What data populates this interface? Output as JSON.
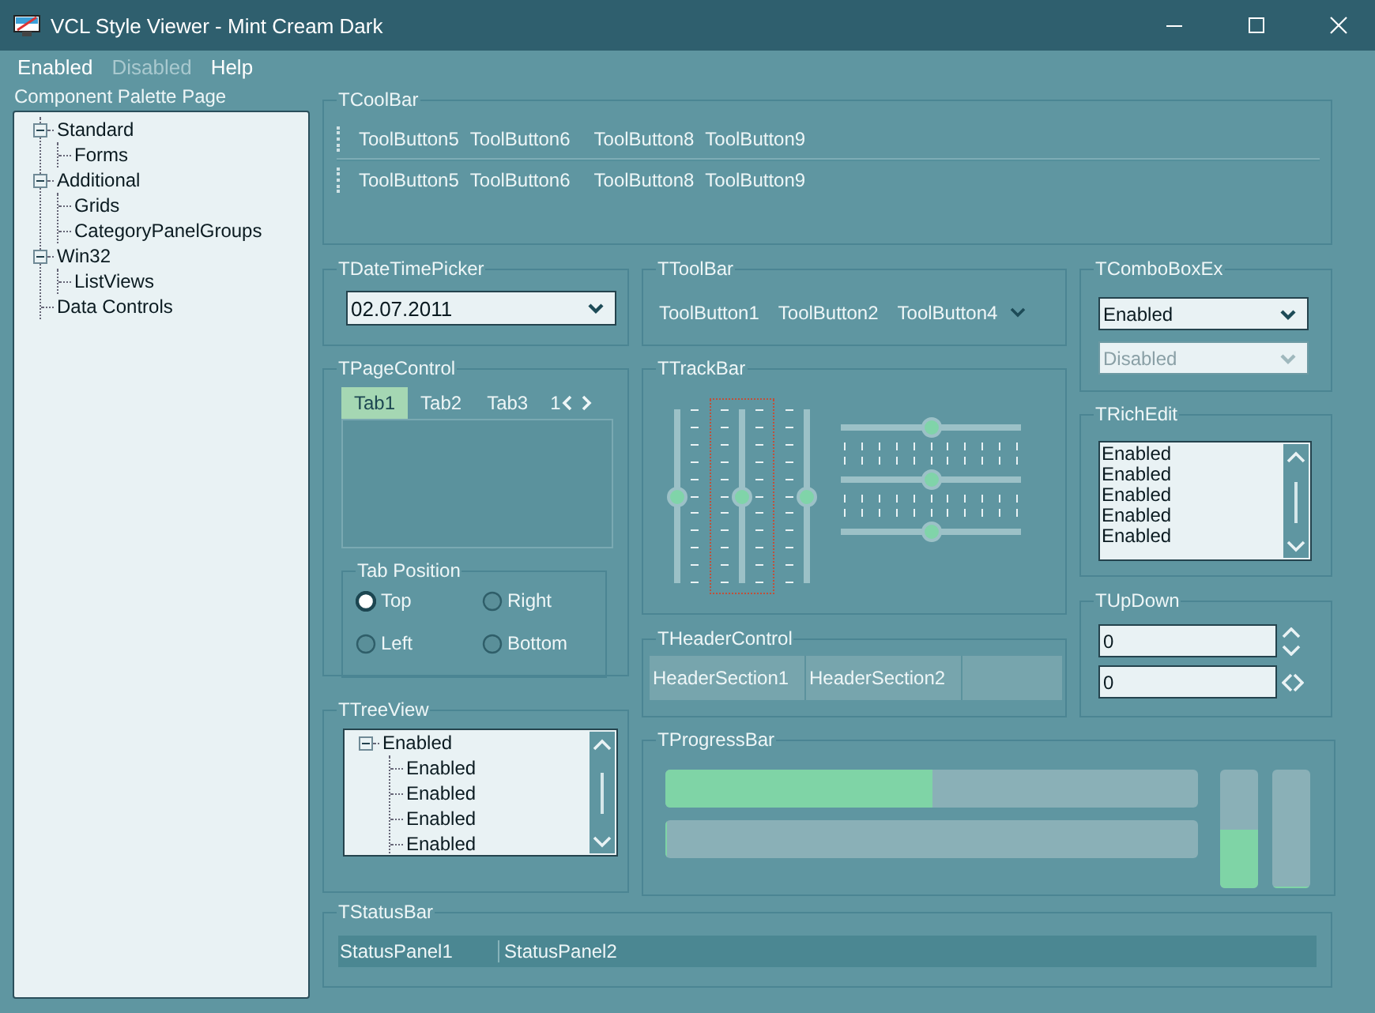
{
  "window": {
    "title": "VCL Style Viewer - Mint Cream Dark"
  },
  "menu": [
    {
      "label": "Enabled",
      "disabled": false
    },
    {
      "label": "Disabled",
      "disabled": true
    },
    {
      "label": "Help",
      "disabled": false
    }
  ],
  "sidebar": {
    "title": "Component Palette Page",
    "tree": [
      {
        "label": "Standard",
        "expanded": true,
        "children": [
          {
            "label": "Forms"
          }
        ]
      },
      {
        "label": "Additional",
        "expanded": true,
        "children": [
          {
            "label": "Grids"
          },
          {
            "label": "CategoryPanelGroups"
          }
        ]
      },
      {
        "label": "Win32",
        "expanded": true,
        "children": [
          {
            "label": "ListViews"
          }
        ]
      },
      {
        "label": "Data Controls"
      }
    ]
  },
  "coolbar": {
    "title": "TCoolBar",
    "bands": [
      {
        "buttons": [
          "ToolButton5",
          "ToolButton6",
          "ToolButton8",
          "ToolButton9"
        ]
      },
      {
        "buttons": [
          "ToolButton5",
          "ToolButton6",
          "ToolButton8",
          "ToolButton9"
        ]
      }
    ]
  },
  "datetimepicker": {
    "title": "TDateTimePicker",
    "value": "02.07.2011"
  },
  "toolbar": {
    "title": "TToolBar",
    "buttons": [
      "ToolButton1",
      "ToolButton2",
      "ToolButton4"
    ]
  },
  "comboboxex": {
    "title": "TComboBoxEx",
    "boxes": [
      {
        "value": "Enabled",
        "disabled": false
      },
      {
        "value": "Disabled",
        "disabled": true
      }
    ]
  },
  "pagecontrol": {
    "title": "TPageControl",
    "tabs": [
      {
        "label": "Tab1",
        "selected": true
      },
      {
        "label": "Tab2",
        "selected": false
      },
      {
        "label": "Tab3",
        "selected": false
      },
      {
        "label": "1",
        "selected": false
      }
    ],
    "tab_position": {
      "title": "Tab Position",
      "options": [
        {
          "label": "Top",
          "selected": true
        },
        {
          "label": "Right",
          "selected": false
        },
        {
          "label": "Left",
          "selected": false
        },
        {
          "label": "Bottom",
          "selected": false
        }
      ]
    }
  },
  "trackbar": {
    "title": "TTrackBar",
    "vertical": [
      {
        "level": 0.5,
        "kind": "right",
        "focused": false
      },
      {
        "level": 0.5,
        "kind": "both",
        "focused": true
      },
      {
        "level": 0.5,
        "kind": "left",
        "focused": false
      }
    ],
    "horizontal": [
      {
        "level": 0.5,
        "kind": "below"
      },
      {
        "level": 0.5,
        "kind": "both"
      },
      {
        "level": 0.5,
        "kind": "above"
      }
    ]
  },
  "richedit": {
    "title": "TRichEdit",
    "lines": [
      "Enabled",
      "Enabled",
      "Enabled",
      "Enabled",
      "Enabled"
    ]
  },
  "updown": {
    "title": "TUpDown",
    "fields": [
      {
        "value": "0",
        "kind": "vertical"
      },
      {
        "value": "0",
        "kind": "horizontal"
      }
    ]
  },
  "headercontrol": {
    "title": "THeaderControl",
    "sections": [
      "HeaderSection1",
      "HeaderSection2"
    ]
  },
  "treeview": {
    "title": "TTreeView",
    "tree": [
      {
        "label": "Enabled",
        "expanded": true,
        "children": [
          {
            "label": "Enabled"
          },
          {
            "label": "Enabled"
          },
          {
            "label": "Enabled"
          },
          {
            "label": "Enabled"
          }
        ]
      }
    ]
  },
  "progressbar": {
    "title": "TProgressBar",
    "horizontal_bars": [
      {
        "level": 0.5
      },
      {
        "level": 0
      }
    ],
    "vertical_bars": [
      {
        "level": 0.5
      },
      {
        "level": 0
      }
    ]
  },
  "status_bar": {
    "title": "TStatusBar",
    "panels": [
      "StatusPanel1",
      "StatusPanel2"
    ]
  }
}
